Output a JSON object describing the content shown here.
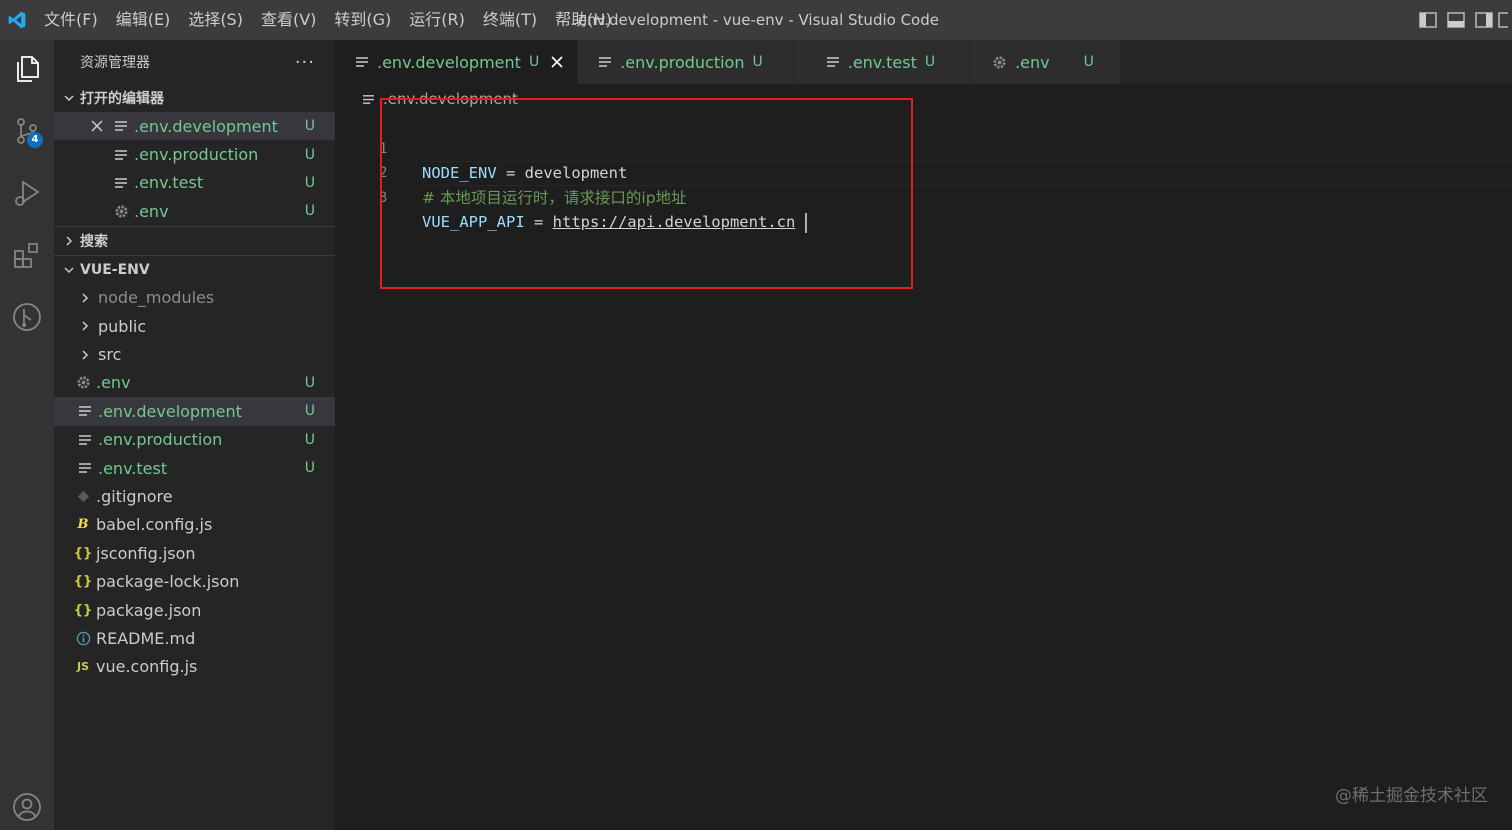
{
  "titlebar": {
    "menu": [
      "文件(F)",
      "编辑(E)",
      "选择(S)",
      "查看(V)",
      "转到(G)",
      "运行(R)",
      "终端(T)",
      "帮助(H)"
    ],
    "window_title": ".env.development - vue-env - Visual Studio Code"
  },
  "activitybar": {
    "scm_badge": "4"
  },
  "sidebar": {
    "title": "资源管理器",
    "more": "···",
    "open_editors_header": "打开的编辑器",
    "open_editors": [
      {
        "label": ".env.development",
        "status": "U"
      },
      {
        "label": ".env.production",
        "status": "U"
      },
      {
        "label": ".env.test",
        "status": "U"
      },
      {
        "label": ".env",
        "status": "U"
      }
    ],
    "search_header": "搜索",
    "project_header": "VUE-ENV",
    "tree": [
      {
        "label": "node_modules",
        "status": ""
      },
      {
        "label": "public",
        "status": ""
      },
      {
        "label": "src",
        "status": ""
      },
      {
        "label": ".env",
        "status": "U"
      },
      {
        "label": ".env.development",
        "status": "U"
      },
      {
        "label": ".env.production",
        "status": "U"
      },
      {
        "label": ".env.test",
        "status": "U"
      },
      {
        "label": ".gitignore",
        "status": ""
      },
      {
        "label": "babel.config.js",
        "status": ""
      },
      {
        "label": "jsconfig.json",
        "status": ""
      },
      {
        "label": "package-lock.json",
        "status": ""
      },
      {
        "label": "package.json",
        "status": ""
      },
      {
        "label": "README.md",
        "status": ""
      },
      {
        "label": "vue.config.js",
        "status": ""
      }
    ]
  },
  "tabs": [
    {
      "label": ".env.development",
      "status": "U"
    },
    {
      "label": ".env.production",
      "status": "U"
    },
    {
      "label": ".env.test",
      "status": "U"
    },
    {
      "label": ".env",
      "status": "U"
    }
  ],
  "breadcrumb": ".env.development",
  "editor": {
    "lines": [
      {
        "num": "1",
        "key": "NODE_ENV",
        "op": " = ",
        "value": "development"
      },
      {
        "num": "2",
        "comment": "# 本地项目运行时，请求接口的ip地址"
      },
      {
        "num": "3",
        "key": "VUE_APP_API",
        "op": " = ",
        "value": "https://api.development.cn"
      }
    ]
  },
  "watermark": "@稀土掘金技术社区",
  "colors": {
    "untracked": "#73c991",
    "highlight_box": "#e02020",
    "accent": "#0e70c0"
  }
}
